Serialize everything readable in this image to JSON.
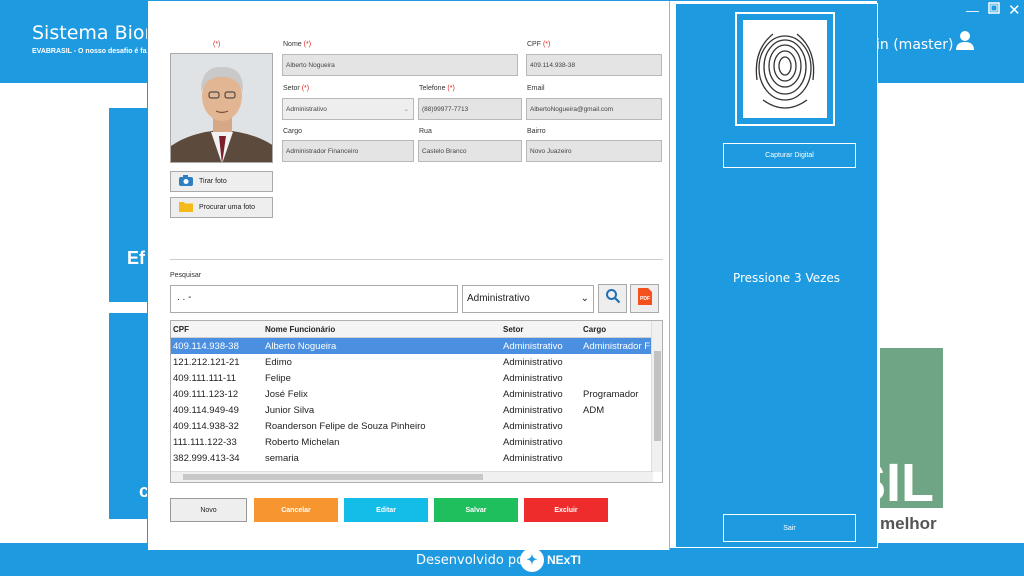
{
  "app": {
    "title": "Sistema Biom",
    "subtitle": "EVABRASIL - O nosso desafio é fazer o",
    "user": "in (master)"
  },
  "background": {
    "tile_text_1": "Ef",
    "tile_text_2": "c",
    "logo_text": "SIL",
    "logo_tagline": "melhor"
  },
  "footer": {
    "text": "Desenvolvido por",
    "brand": "NExTI"
  },
  "form": {
    "photo_required": "(*)",
    "required_mark": "(*)",
    "nome": {
      "label": "Nome",
      "value": "Alberto Nogueira"
    },
    "cpf": {
      "label": "CPF",
      "value": "409.114.938-38"
    },
    "setor": {
      "label": "Setor",
      "value": "Administrativo"
    },
    "telefone": {
      "label": "Telefone",
      "value": "(88)99977-7713"
    },
    "email": {
      "label": "Email",
      "value": "AlbertoNogueira@gmail.com"
    },
    "cargo": {
      "label": "Cargo",
      "value": "Administrador Financeiro"
    },
    "rua": {
      "label": "Rua",
      "value": "Castelo Branco"
    },
    "bairro": {
      "label": "Bairro",
      "value": "Novo Juazeiro"
    },
    "tirar_foto": "Tirar foto",
    "procurar_foto": "Procurar uma foto"
  },
  "search": {
    "label": "Pesquisar",
    "value": ". .  -",
    "setor_value": "Administrativo"
  },
  "table": {
    "headers": [
      "CPF",
      "Nome Funcionário",
      "Setor",
      "Cargo"
    ],
    "rows": [
      [
        "409.114.938-38",
        "Alberto Nogueira",
        "Administrativo",
        "Administrador F"
      ],
      [
        "121.212.121-21",
        "Edimo",
        "Administrativo",
        ""
      ],
      [
        "409.111.111-11",
        "Felipe",
        "Administrativo",
        ""
      ],
      [
        "409.111.123-12",
        "José Felix",
        "Administrativo",
        "Programador"
      ],
      [
        "409.114.949-49",
        "Junior Silva",
        "Administrativo",
        "ADM"
      ],
      [
        "409.114.938-32",
        "Roanderson Felipe de Souza Pinheiro",
        "Administrativo",
        ""
      ],
      [
        "111.111.122-33",
        "Roberto Michelan",
        "Administrativo",
        ""
      ],
      [
        "382.999.413-34",
        "semaria",
        "Administrativo",
        ""
      ]
    ]
  },
  "actions": {
    "novo": "Novo",
    "cancelar": "Cancelar",
    "editar": "Editar",
    "salvar": "Salvar",
    "excluir": "Excluir"
  },
  "biometria": {
    "capturar": "Capturar Digital",
    "instrucao": "Pressione 3 Vezes",
    "sair": "Sair"
  },
  "colors": {
    "primary": "#1e9ae0",
    "cancelar": "#f7962e",
    "editar": "#13bde8",
    "salvar": "#1fbf5d",
    "excluir": "#ee2c2c",
    "selected_row": "#4a8fe0"
  }
}
